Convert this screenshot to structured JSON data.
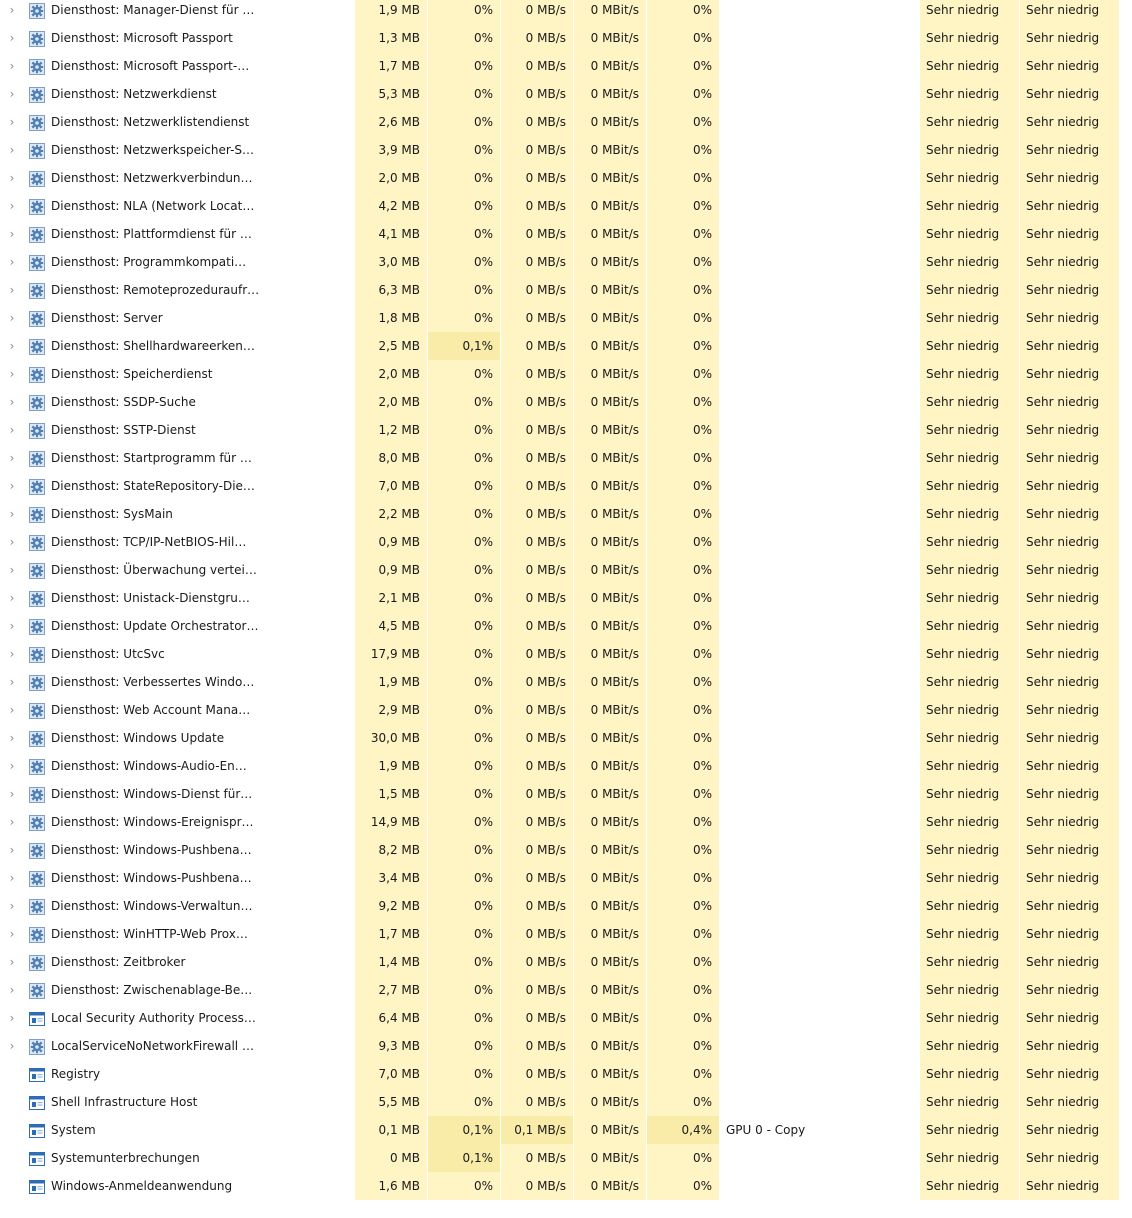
{
  "colors": {
    "heat_low": "#fff4c4",
    "heat_mid": "#f9eca8",
    "service_icon": "#5b8fc7"
  },
  "rows": [
    {
      "name": "Diensthost: Manager-Dienst für …",
      "mem": "1,9 MB",
      "cpu": "0%",
      "disk": "0 MB/s",
      "net": "0 MBit/s",
      "gpu": "0%",
      "engine": "",
      "power": "Sehr niedrig",
      "power_trend": "Sehr niedrig",
      "icon": "gear-icon",
      "expandable": true
    },
    {
      "name": "Diensthost: Microsoft Passport",
      "mem": "1,3 MB",
      "cpu": "0%",
      "disk": "0 MB/s",
      "net": "0 MBit/s",
      "gpu": "0%",
      "engine": "",
      "power": "Sehr niedrig",
      "power_trend": "Sehr niedrig",
      "icon": "gear-icon",
      "expandable": true
    },
    {
      "name": "Diensthost: Microsoft Passport-…",
      "mem": "1,7 MB",
      "cpu": "0%",
      "disk": "0 MB/s",
      "net": "0 MBit/s",
      "gpu": "0%",
      "engine": "",
      "power": "Sehr niedrig",
      "power_trend": "Sehr niedrig",
      "icon": "gear-icon",
      "expandable": true
    },
    {
      "name": "Diensthost: Netzwerkdienst",
      "mem": "5,3 MB",
      "cpu": "0%",
      "disk": "0 MB/s",
      "net": "0 MBit/s",
      "gpu": "0%",
      "engine": "",
      "power": "Sehr niedrig",
      "power_trend": "Sehr niedrig",
      "icon": "gear-icon",
      "expandable": true
    },
    {
      "name": "Diensthost: Netzwerklistendienst",
      "mem": "2,6 MB",
      "cpu": "0%",
      "disk": "0 MB/s",
      "net": "0 MBit/s",
      "gpu": "0%",
      "engine": "",
      "power": "Sehr niedrig",
      "power_trend": "Sehr niedrig",
      "icon": "gear-icon",
      "expandable": true
    },
    {
      "name": "Diensthost: Netzwerkspeicher-S…",
      "mem": "3,9 MB",
      "cpu": "0%",
      "disk": "0 MB/s",
      "net": "0 MBit/s",
      "gpu": "0%",
      "engine": "",
      "power": "Sehr niedrig",
      "power_trend": "Sehr niedrig",
      "icon": "gear-icon",
      "expandable": true
    },
    {
      "name": "Diensthost: Netzwerkverbindun…",
      "mem": "2,0 MB",
      "cpu": "0%",
      "disk": "0 MB/s",
      "net": "0 MBit/s",
      "gpu": "0%",
      "engine": "",
      "power": "Sehr niedrig",
      "power_trend": "Sehr niedrig",
      "icon": "gear-icon",
      "expandable": true
    },
    {
      "name": "Diensthost: NLA (Network Locat…",
      "mem": "4,2 MB",
      "cpu": "0%",
      "disk": "0 MB/s",
      "net": "0 MBit/s",
      "gpu": "0%",
      "engine": "",
      "power": "Sehr niedrig",
      "power_trend": "Sehr niedrig",
      "icon": "gear-icon",
      "expandable": true
    },
    {
      "name": "Diensthost: Plattformdienst für …",
      "mem": "4,1 MB",
      "cpu": "0%",
      "disk": "0 MB/s",
      "net": "0 MBit/s",
      "gpu": "0%",
      "engine": "",
      "power": "Sehr niedrig",
      "power_trend": "Sehr niedrig",
      "icon": "gear-icon",
      "expandable": true
    },
    {
      "name": "Diensthost: Programmkompati…",
      "mem": "3,0 MB",
      "cpu": "0%",
      "disk": "0 MB/s",
      "net": "0 MBit/s",
      "gpu": "0%",
      "engine": "",
      "power": "Sehr niedrig",
      "power_trend": "Sehr niedrig",
      "icon": "gear-icon",
      "expandable": true
    },
    {
      "name": "Diensthost: Remoteprozeduraufr…",
      "mem": "6,3 MB",
      "cpu": "0%",
      "disk": "0 MB/s",
      "net": "0 MBit/s",
      "gpu": "0%",
      "engine": "",
      "power": "Sehr niedrig",
      "power_trend": "Sehr niedrig",
      "icon": "gear-icon",
      "expandable": true
    },
    {
      "name": "Diensthost: Server",
      "mem": "1,8 MB",
      "cpu": "0%",
      "disk": "0 MB/s",
      "net": "0 MBit/s",
      "gpu": "0%",
      "engine": "",
      "power": "Sehr niedrig",
      "power_trend": "Sehr niedrig",
      "icon": "gear-icon",
      "expandable": true
    },
    {
      "name": "Diensthost: Shellhardwareerken…",
      "mem": "2,5 MB",
      "cpu": "0,1%",
      "disk": "0 MB/s",
      "net": "0 MBit/s",
      "gpu": "0%",
      "engine": "",
      "power": "Sehr niedrig",
      "power_trend": "Sehr niedrig",
      "icon": "gear-icon",
      "expandable": true
    },
    {
      "name": "Diensthost: Speicherdienst",
      "mem": "2,0 MB",
      "cpu": "0%",
      "disk": "0 MB/s",
      "net": "0 MBit/s",
      "gpu": "0%",
      "engine": "",
      "power": "Sehr niedrig",
      "power_trend": "Sehr niedrig",
      "icon": "gear-icon",
      "expandable": true
    },
    {
      "name": "Diensthost: SSDP-Suche",
      "mem": "2,0 MB",
      "cpu": "0%",
      "disk": "0 MB/s",
      "net": "0 MBit/s",
      "gpu": "0%",
      "engine": "",
      "power": "Sehr niedrig",
      "power_trend": "Sehr niedrig",
      "icon": "gear-icon",
      "expandable": true
    },
    {
      "name": "Diensthost: SSTP-Dienst",
      "mem": "1,2 MB",
      "cpu": "0%",
      "disk": "0 MB/s",
      "net": "0 MBit/s",
      "gpu": "0%",
      "engine": "",
      "power": "Sehr niedrig",
      "power_trend": "Sehr niedrig",
      "icon": "gear-icon",
      "expandable": true
    },
    {
      "name": "Diensthost: Startprogramm für …",
      "mem": "8,0 MB",
      "cpu": "0%",
      "disk": "0 MB/s",
      "net": "0 MBit/s",
      "gpu": "0%",
      "engine": "",
      "power": "Sehr niedrig",
      "power_trend": "Sehr niedrig",
      "icon": "gear-icon",
      "expandable": true
    },
    {
      "name": "Diensthost: StateRepository-Die…",
      "mem": "7,0 MB",
      "cpu": "0%",
      "disk": "0 MB/s",
      "net": "0 MBit/s",
      "gpu": "0%",
      "engine": "",
      "power": "Sehr niedrig",
      "power_trend": "Sehr niedrig",
      "icon": "gear-icon",
      "expandable": true
    },
    {
      "name": "Diensthost: SysMain",
      "mem": "2,2 MB",
      "cpu": "0%",
      "disk": "0 MB/s",
      "net": "0 MBit/s",
      "gpu": "0%",
      "engine": "",
      "power": "Sehr niedrig",
      "power_trend": "Sehr niedrig",
      "icon": "gear-icon",
      "expandable": true
    },
    {
      "name": "Diensthost: TCP/IP-NetBIOS-Hil…",
      "mem": "0,9 MB",
      "cpu": "0%",
      "disk": "0 MB/s",
      "net": "0 MBit/s",
      "gpu": "0%",
      "engine": "",
      "power": "Sehr niedrig",
      "power_trend": "Sehr niedrig",
      "icon": "gear-icon",
      "expandable": true
    },
    {
      "name": "Diensthost: Überwachung vertei…",
      "mem": "0,9 MB",
      "cpu": "0%",
      "disk": "0 MB/s",
      "net": "0 MBit/s",
      "gpu": "0%",
      "engine": "",
      "power": "Sehr niedrig",
      "power_trend": "Sehr niedrig",
      "icon": "gear-icon",
      "expandable": true
    },
    {
      "name": "Diensthost: Unistack-Dienstgru…",
      "mem": "2,1 MB",
      "cpu": "0%",
      "disk": "0 MB/s",
      "net": "0 MBit/s",
      "gpu": "0%",
      "engine": "",
      "power": "Sehr niedrig",
      "power_trend": "Sehr niedrig",
      "icon": "gear-icon",
      "expandable": true
    },
    {
      "name": "Diensthost: Update Orchestrator…",
      "mem": "4,5 MB",
      "cpu": "0%",
      "disk": "0 MB/s",
      "net": "0 MBit/s",
      "gpu": "0%",
      "engine": "",
      "power": "Sehr niedrig",
      "power_trend": "Sehr niedrig",
      "icon": "gear-icon",
      "expandable": true
    },
    {
      "name": "Diensthost: UtcSvc",
      "mem": "17,9 MB",
      "cpu": "0%",
      "disk": "0 MB/s",
      "net": "0 MBit/s",
      "gpu": "0%",
      "engine": "",
      "power": "Sehr niedrig",
      "power_trend": "Sehr niedrig",
      "icon": "gear-icon",
      "expandable": true
    },
    {
      "name": "Diensthost: Verbessertes Windo…",
      "mem": "1,9 MB",
      "cpu": "0%",
      "disk": "0 MB/s",
      "net": "0 MBit/s",
      "gpu": "0%",
      "engine": "",
      "power": "Sehr niedrig",
      "power_trend": "Sehr niedrig",
      "icon": "gear-icon",
      "expandable": true
    },
    {
      "name": "Diensthost: Web Account Mana…",
      "mem": "2,9 MB",
      "cpu": "0%",
      "disk": "0 MB/s",
      "net": "0 MBit/s",
      "gpu": "0%",
      "engine": "",
      "power": "Sehr niedrig",
      "power_trend": "Sehr niedrig",
      "icon": "gear-icon",
      "expandable": true
    },
    {
      "name": "Diensthost: Windows Update",
      "mem": "30,0 MB",
      "cpu": "0%",
      "disk": "0 MB/s",
      "net": "0 MBit/s",
      "gpu": "0%",
      "engine": "",
      "power": "Sehr niedrig",
      "power_trend": "Sehr niedrig",
      "icon": "gear-icon",
      "expandable": true
    },
    {
      "name": "Diensthost: Windows-Audio-En…",
      "mem": "1,9 MB",
      "cpu": "0%",
      "disk": "0 MB/s",
      "net": "0 MBit/s",
      "gpu": "0%",
      "engine": "",
      "power": "Sehr niedrig",
      "power_trend": "Sehr niedrig",
      "icon": "gear-icon",
      "expandable": true
    },
    {
      "name": "Diensthost: Windows-Dienst für…",
      "mem": "1,5 MB",
      "cpu": "0%",
      "disk": "0 MB/s",
      "net": "0 MBit/s",
      "gpu": "0%",
      "engine": "",
      "power": "Sehr niedrig",
      "power_trend": "Sehr niedrig",
      "icon": "gear-icon",
      "expandable": true
    },
    {
      "name": "Diensthost: Windows-Ereignispr…",
      "mem": "14,9 MB",
      "cpu": "0%",
      "disk": "0 MB/s",
      "net": "0 MBit/s",
      "gpu": "0%",
      "engine": "",
      "power": "Sehr niedrig",
      "power_trend": "Sehr niedrig",
      "icon": "gear-icon",
      "expandable": true
    },
    {
      "name": "Diensthost: Windows-Pushbena…",
      "mem": "8,2 MB",
      "cpu": "0%",
      "disk": "0 MB/s",
      "net": "0 MBit/s",
      "gpu": "0%",
      "engine": "",
      "power": "Sehr niedrig",
      "power_trend": "Sehr niedrig",
      "icon": "gear-icon",
      "expandable": true
    },
    {
      "name": "Diensthost: Windows-Pushbena…",
      "mem": "3,4 MB",
      "cpu": "0%",
      "disk": "0 MB/s",
      "net": "0 MBit/s",
      "gpu": "0%",
      "engine": "",
      "power": "Sehr niedrig",
      "power_trend": "Sehr niedrig",
      "icon": "gear-icon",
      "expandable": true
    },
    {
      "name": "Diensthost: Windows-Verwaltun…",
      "mem": "9,2 MB",
      "cpu": "0%",
      "disk": "0 MB/s",
      "net": "0 MBit/s",
      "gpu": "0%",
      "engine": "",
      "power": "Sehr niedrig",
      "power_trend": "Sehr niedrig",
      "icon": "gear-icon",
      "expandable": true
    },
    {
      "name": "Diensthost: WinHTTP-Web Prox…",
      "mem": "1,7 MB",
      "cpu": "0%",
      "disk": "0 MB/s",
      "net": "0 MBit/s",
      "gpu": "0%",
      "engine": "",
      "power": "Sehr niedrig",
      "power_trend": "Sehr niedrig",
      "icon": "gear-icon",
      "expandable": true
    },
    {
      "name": "Diensthost: Zeitbroker",
      "mem": "1,4 MB",
      "cpu": "0%",
      "disk": "0 MB/s",
      "net": "0 MBit/s",
      "gpu": "0%",
      "engine": "",
      "power": "Sehr niedrig",
      "power_trend": "Sehr niedrig",
      "icon": "gear-icon",
      "expandable": true
    },
    {
      "name": "Diensthost: Zwischenablage-Be…",
      "mem": "2,7 MB",
      "cpu": "0%",
      "disk": "0 MB/s",
      "net": "0 MBit/s",
      "gpu": "0%",
      "engine": "",
      "power": "Sehr niedrig",
      "power_trend": "Sehr niedrig",
      "icon": "gear-icon",
      "expandable": true
    },
    {
      "name": "Local Security Authority Process…",
      "mem": "6,4 MB",
      "cpu": "0%",
      "disk": "0 MB/s",
      "net": "0 MBit/s",
      "gpu": "0%",
      "engine": "",
      "power": "Sehr niedrig",
      "power_trend": "Sehr niedrig",
      "icon": "window-icon",
      "expandable": true
    },
    {
      "name": "LocalServiceNoNetworkFirewall …",
      "mem": "9,3 MB",
      "cpu": "0%",
      "disk": "0 MB/s",
      "net": "0 MBit/s",
      "gpu": "0%",
      "engine": "",
      "power": "Sehr niedrig",
      "power_trend": "Sehr niedrig",
      "icon": "gear-icon",
      "expandable": true
    },
    {
      "name": "Registry",
      "mem": "7,0 MB",
      "cpu": "0%",
      "disk": "0 MB/s",
      "net": "0 MBit/s",
      "gpu": "0%",
      "engine": "",
      "power": "Sehr niedrig",
      "power_trend": "Sehr niedrig",
      "icon": "window-icon",
      "expandable": false
    },
    {
      "name": "Shell Infrastructure Host",
      "mem": "5,5 MB",
      "cpu": "0%",
      "disk": "0 MB/s",
      "net": "0 MBit/s",
      "gpu": "0%",
      "engine": "",
      "power": "Sehr niedrig",
      "power_trend": "Sehr niedrig",
      "icon": "window-icon",
      "expandable": false
    },
    {
      "name": "System",
      "mem": "0,1 MB",
      "cpu": "0,1%",
      "disk": "0,1 MB/s",
      "net": "0 MBit/s",
      "gpu": "0,4%",
      "engine": "GPU 0 - Copy",
      "power": "Sehr niedrig",
      "power_trend": "Sehr niedrig",
      "icon": "window-icon",
      "expandable": false
    },
    {
      "name": "Systemunterbrechungen",
      "mem": "0 MB",
      "cpu": "0,1%",
      "disk": "0 MB/s",
      "net": "0 MBit/s",
      "gpu": "0%",
      "engine": "",
      "power": "Sehr niedrig",
      "power_trend": "Sehr niedrig",
      "icon": "window-icon",
      "expandable": false
    },
    {
      "name": "Windows-Anmeldeanwendung",
      "mem": "1,6 MB",
      "cpu": "0%",
      "disk": "0 MB/s",
      "net": "0 MBit/s",
      "gpu": "0%",
      "engine": "",
      "power": "Sehr niedrig",
      "power_trend": "Sehr niedrig",
      "icon": "window-icon",
      "expandable": false
    }
  ]
}
